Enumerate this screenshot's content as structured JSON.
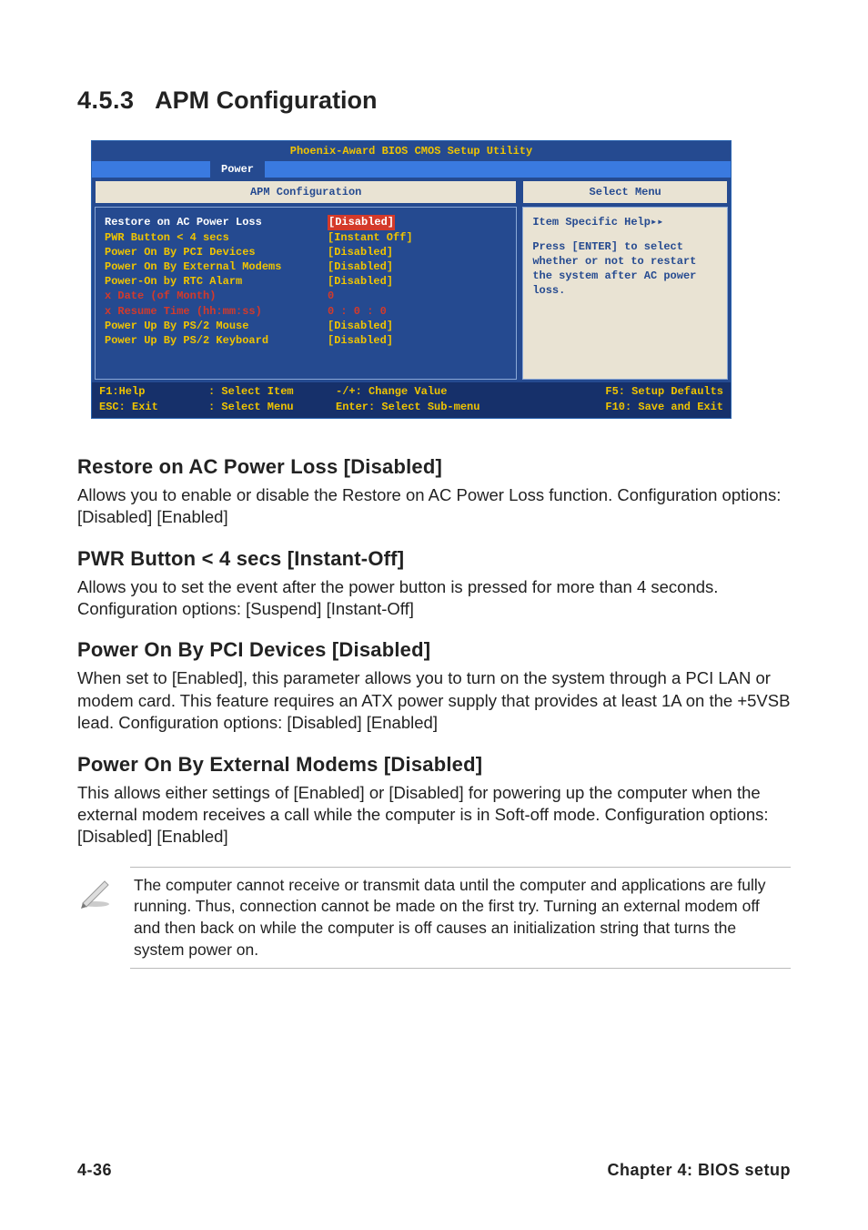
{
  "section": {
    "number": "4.5.3",
    "title": "APM Configuration"
  },
  "bios": {
    "title": "Phoenix-Award BIOS CMOS Setup Utility",
    "active_tab": "Power",
    "left_header": "APM Configuration",
    "right_header": "Select Menu",
    "rows": [
      {
        "label": "Restore on AC Power Loss",
        "value": "[Disabled]",
        "label_cls": "white",
        "val_cls": "hl"
      },
      {
        "label": "PWR Button < 4 secs",
        "value": "[Instant Off]",
        "label_cls": "yellow",
        "val_cls": "yellow"
      },
      {
        "label": "Power On By PCI Devices",
        "value": "[Disabled]",
        "label_cls": "yellow",
        "val_cls": "yellow"
      },
      {
        "label": "Power On By External Modems",
        "value": "[Disabled]",
        "label_cls": "yellow",
        "val_cls": "yellow"
      },
      {
        "label": "Power-On by RTC Alarm",
        "value": "[Disabled]",
        "label_cls": "yellow",
        "val_cls": "yellow"
      },
      {
        "label": "x Date (of Month)",
        "value": "  0",
        "label_cls": "red",
        "val_cls": "red"
      },
      {
        "label": "x Resume Time (hh:mm:ss)",
        "value": "0 : 0 : 0",
        "label_cls": "red",
        "val_cls": "red"
      },
      {
        "label": "  Power Up By PS/2 Mouse",
        "value": "[Disabled]",
        "label_cls": "yellow",
        "val_cls": "yellow"
      },
      {
        "label": "  Power Up By PS/2 Keyboard",
        "value": "[Disabled]",
        "label_cls": "yellow",
        "val_cls": "yellow"
      }
    ],
    "help_title": "Item Specific Help▸▸",
    "help_body": "Press [ENTER] to select whether or not to restart the system after AC power loss.",
    "foot": {
      "c1a": "F1:Help",
      "c1b": "ESC: Exit",
      "c2a": ": Select Item",
      "c2b": ": Select Menu",
      "c3a": "-/+: Change Value",
      "c3b": "Enter: Select Sub-menu",
      "c4a": "F5: Setup Defaults",
      "c4b": "F10: Save and Exit"
    }
  },
  "subs": [
    {
      "heading": "Restore on AC Power Loss [Disabled]",
      "body": "Allows you to enable or disable the Restore on AC Power Loss function. Configuration options: [Disabled] [Enabled]"
    },
    {
      "heading": "PWR Button < 4 secs [Instant-Off]",
      "body": "Allows you to set the event after the power button is pressed for more than 4 seconds. Configuration options: [Suspend] [Instant-Off]"
    },
    {
      "heading": "Power On By PCI Devices [Disabled]",
      "body": "When set to [Enabled], this parameter allows you to turn on the system through a PCI LAN or modem card. This feature requires an ATX power supply that provides at least 1A on the +5VSB lead. Configuration options: [Disabled] [Enabled]"
    },
    {
      "heading": "Power On By External Modems [Disabled]",
      "body": "This allows either settings of [Enabled] or [Disabled] for powering up the computer when the external modem receives a call while the computer is in Soft-off mode. Configuration options: [Disabled] [Enabled]"
    }
  ],
  "note": "The computer cannot receive or transmit data until the computer and applications are fully running. Thus, connection cannot be made on the first try. Turning an external modem off and then back on while the computer is off causes an initialization string that turns the system power on.",
  "footer": {
    "left": "4-36",
    "right": "Chapter 4: BIOS setup"
  }
}
